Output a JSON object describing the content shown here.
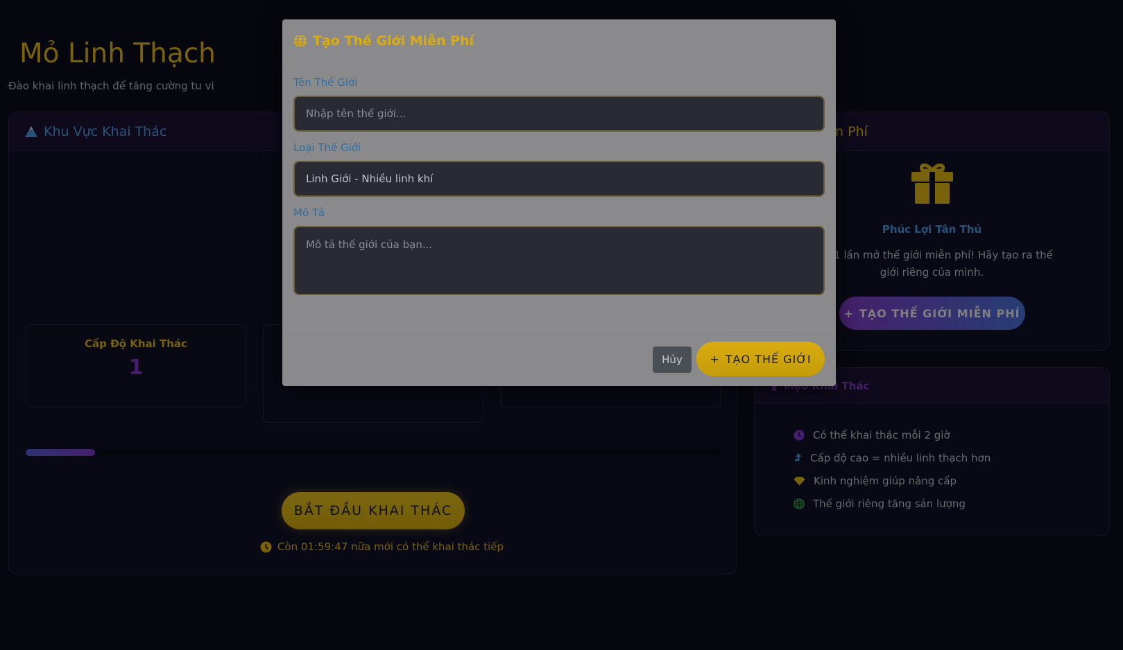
{
  "page": {
    "title": "Mỏ Linh Thạch",
    "subtitle": "Đào khai linh thạch để tăng cường tu vi"
  },
  "mining": {
    "header": "Khu Vực Khai Thác",
    "stat_level_label": "Cấp Độ Khai Thác",
    "stat_level_value": "1",
    "progress_fraction": 0.1,
    "start_button": "BẮT ĐẦU KHAI THÁC",
    "cooldown_text": "Còn 01:59:47 nữa mới có thể khai thác tiếp"
  },
  "gift": {
    "header": "ế Giới Miễn Phí",
    "title": "Phúc Lợi Tân Thủ",
    "description": "ặng 1 lần mở thế giới miễn phí! Hãy tạo ra thế giới riêng của mình.",
    "button": "TẠO THẾ GIỚI MIỄN PHÍ"
  },
  "tips": {
    "header": "Mẹo Khai Thác",
    "items": [
      {
        "icon": "clock-icon",
        "text": "Có thể khai thác mỗi 2 giờ",
        "color": "#8c3dd8"
      },
      {
        "icon": "level-up-icon",
        "text": "Cấp độ cao = nhiều linh thạch hơn",
        "color": "#4fa6f2"
      },
      {
        "icon": "gem-icon",
        "text": "Kinh nghiệm giúp nâng cấp",
        "color": "#f0c419"
      },
      {
        "icon": "globe-icon",
        "text": "Thế giới riêng tăng sản lượng",
        "color": "#2fa84f"
      }
    ]
  },
  "modal": {
    "title": "Tạo Thế Giới Miễn Phí",
    "name_label": "Tên Thế Giới",
    "name_placeholder": "Nhập tên thế giới...",
    "type_label": "Loại Thế Giới",
    "type_value": "Linh Giới - Nhiều linh khí",
    "desc_label": "Mô Tả",
    "desc_placeholder": "Mô tả thế giới của bạn...",
    "cancel_button": "Hủy",
    "create_button": "TẠO THẾ GIỚI"
  },
  "colors": {
    "gold": "#f0c419",
    "blue": "#4fa6f2",
    "purple": "#8c3dd8",
    "background": "#0d0d1c"
  }
}
